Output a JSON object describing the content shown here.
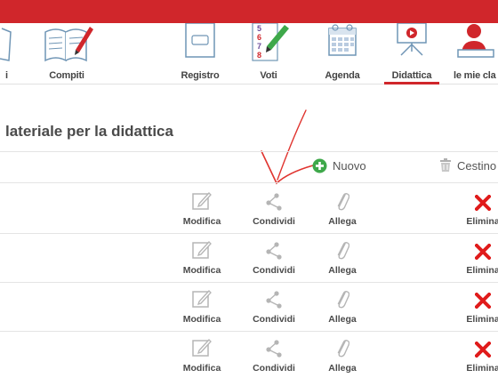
{
  "nav": {
    "items": [
      {
        "label": "i",
        "active": false
      },
      {
        "label": "Compiti",
        "active": false
      },
      {
        "label": "Registro",
        "active": false
      },
      {
        "label": "Voti",
        "active": false
      },
      {
        "label": "Agenda",
        "active": false
      },
      {
        "label": "Didattica",
        "active": true
      },
      {
        "label": "le mie cla",
        "active": false
      }
    ],
    "voti_icon_digits": [
      "5",
      "6",
      "7",
      "8"
    ]
  },
  "page": {
    "title": "lateriale per la didattica"
  },
  "toolbar": {
    "new_label": "Nuovo",
    "trash_label": "Cestino"
  },
  "rows": [
    {
      "actions": {
        "edit": "Modifica",
        "share": "Condividi",
        "attach": "Allega",
        "delete": "Elimina"
      }
    },
    {
      "actions": {
        "edit": "Modifica",
        "share": "Condividi",
        "attach": "Allega",
        "delete": "Elimina"
      }
    },
    {
      "actions": {
        "edit": "Modifica",
        "share": "Condividi",
        "attach": "Allega",
        "delete": "Elimina"
      }
    },
    {
      "actions": {
        "edit": "Modifica",
        "share": "Condividi",
        "attach": "Allega",
        "delete": "Elimina"
      }
    }
  ],
  "colors": {
    "brand_red": "#d0262b",
    "new_green": "#3ea84a",
    "icon_gray": "#b5b5b5",
    "delete_red": "#e01b1b"
  }
}
